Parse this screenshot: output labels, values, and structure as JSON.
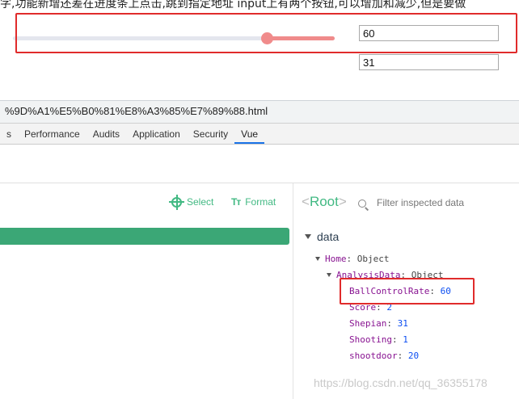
{
  "page": {
    "top_text": "字,功能新增还差在进度条上点击,跳到指定地址 input上有两个按钮,可以增加和减少,但是要做",
    "slider": {
      "value": 60,
      "max": 100
    },
    "input_primary": "60",
    "input_secondary": "31"
  },
  "devtools": {
    "url": "%9D%A1%E5%B0%81%E8%A3%85%E7%89%88.html",
    "tabs": [
      {
        "label": "s"
      },
      {
        "label": "Performance"
      },
      {
        "label": "Audits"
      },
      {
        "label": "Application"
      },
      {
        "label": "Security"
      },
      {
        "label": "Vue",
        "active": true
      }
    ],
    "toolbar": {
      "select_label": "Select",
      "format_label": "Format",
      "format_icon": "Tт"
    },
    "inspector": {
      "root_open": "<",
      "root_label": "Root",
      "root_close": ">",
      "filter_placeholder": "Filter inspected data",
      "section": "data",
      "home_key": "Home",
      "home_value": "Object",
      "analysis_key": "AnalysisData",
      "analysis_value": "Object",
      "fields": [
        {
          "key": "BallControlRate",
          "value": "60"
        },
        {
          "key": "Score",
          "value": "2"
        },
        {
          "key": "Shepian",
          "value": "31"
        },
        {
          "key": "Shooting",
          "value": "1"
        },
        {
          "key": "shootdoor",
          "value": "20"
        }
      ]
    }
  },
  "watermark": "https://blog.csdn.net/qq_36355178",
  "colors": {
    "accent_green": "#42b983",
    "highlight_red": "#e02b2b",
    "slider": "#f08b8b"
  }
}
